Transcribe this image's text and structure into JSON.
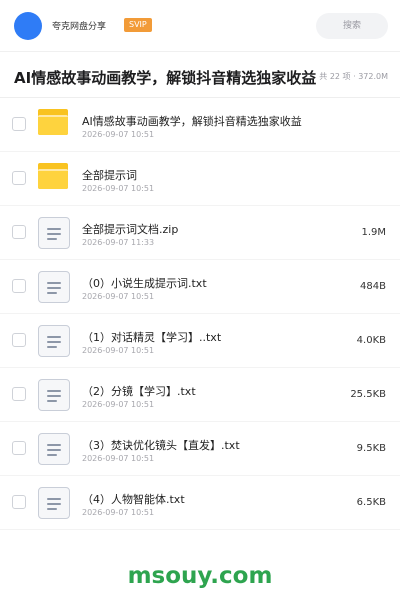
{
  "header": {
    "brand_name": "夸克网盘分享",
    "badge": "SVIP",
    "search_placeholder": "搜索"
  },
  "share": {
    "title": "AI情感故事动画教学，解锁抖音精选独家收益",
    "meta": "共 22 项 · 372.0M"
  },
  "files": [
    {
      "name": "AI情感故事动画教学，解锁抖音精选独家收益",
      "date": "2026-09-07 10:51",
      "size": "",
      "type": "folder-icon"
    },
    {
      "name": "全部提示词",
      "date": "2026-09-07 10:51",
      "size": "",
      "type": "folder-icon"
    },
    {
      "name": "全部提示词文档.zip",
      "date": "2026-09-07 11:33",
      "size": "1.9M",
      "type": "document-icon"
    },
    {
      "name": "（0）小说生成提示词.txt",
      "date": "2026-09-07 10:51",
      "size": "484B",
      "type": "document-icon"
    },
    {
      "name": "（1）对话精灵【学习】..txt",
      "date": "2026-09-07 10:51",
      "size": "4.0KB",
      "type": "document-icon"
    },
    {
      "name": "（2）分镜【学习】.txt",
      "date": "2026-09-07 10:51",
      "size": "25.5KB",
      "type": "document-icon"
    },
    {
      "name": "（3）焚诀优化镜头【直发】.txt",
      "date": "2026-09-07 10:51",
      "size": "9.5KB",
      "type": "document-icon"
    },
    {
      "name": "（4）人物智能体.txt",
      "date": "2026-09-07 10:51",
      "size": "6.5KB",
      "type": "document-icon"
    }
  ],
  "watermark": "msouy.com",
  "colors": {
    "accent": "#2f7cf6",
    "svip_badge": "#f29b38",
    "folder": "#fed33e",
    "watermark": "#2ea44f"
  }
}
